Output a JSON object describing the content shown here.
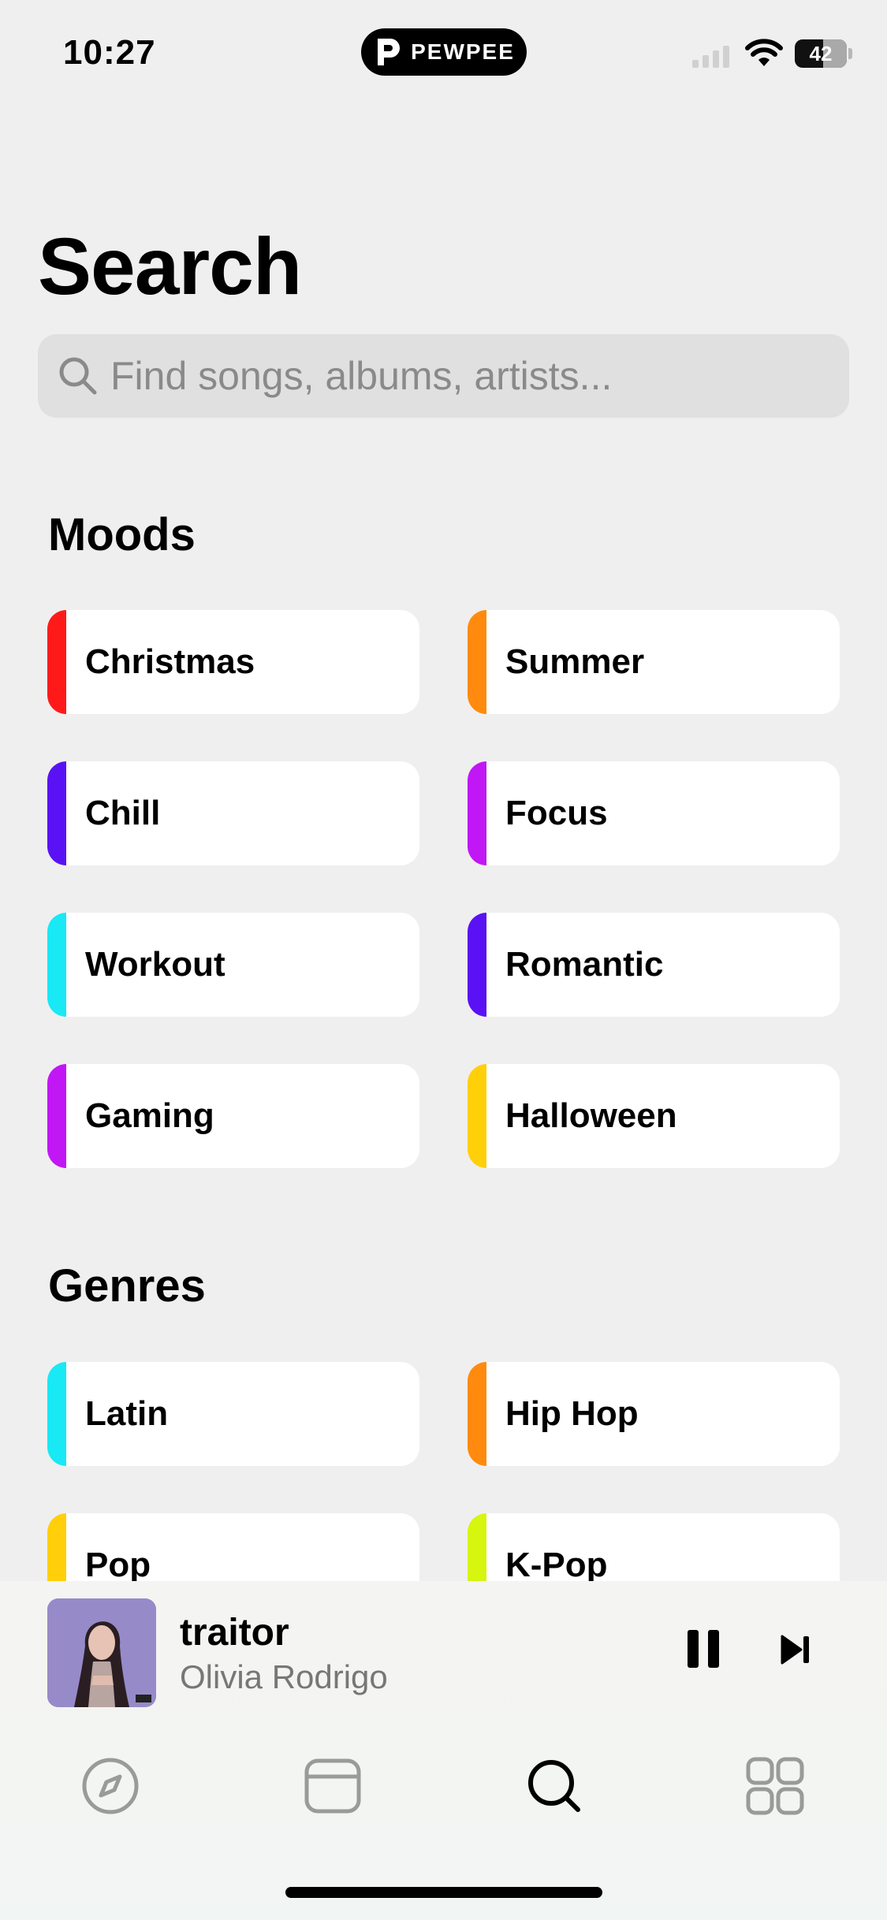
{
  "status_bar": {
    "time": "10:27",
    "app_badge": "PEWPEE",
    "battery": "42"
  },
  "header": {
    "title": "Search"
  },
  "search": {
    "placeholder": "Find songs, albums, artists..."
  },
  "moods": {
    "title": "Moods",
    "items": [
      {
        "label": "Christmas",
        "color": "#ff1a1a"
      },
      {
        "label": "Summer",
        "color": "#ff8a0d"
      },
      {
        "label": "Chill",
        "color": "#5a12f5"
      },
      {
        "label": "Focus",
        "color": "#c117f5"
      },
      {
        "label": "Workout",
        "color": "#19e8f5"
      },
      {
        "label": "Romantic",
        "color": "#5a12f5"
      },
      {
        "label": "Gaming",
        "color": "#c117f5"
      },
      {
        "label": "Halloween",
        "color": "#ffcf0a"
      }
    ]
  },
  "genres": {
    "title": "Genres",
    "items": [
      {
        "label": "Latin",
        "color": "#19e8f5"
      },
      {
        "label": "Hip Hop",
        "color": "#ff8a0d"
      },
      {
        "label": "Pop",
        "color": "#ffcf0a"
      },
      {
        "label": "K-Pop",
        "color": "#d6f50f"
      }
    ]
  },
  "now_playing": {
    "title": "traitor",
    "artist": "Olivia Rodrigo"
  },
  "tabs": [
    {
      "icon": "compass-icon",
      "name": "tab-explore"
    },
    {
      "icon": "card-icon",
      "name": "tab-library"
    },
    {
      "icon": "search-icon",
      "name": "tab-search",
      "active": true
    },
    {
      "icon": "grid-icon",
      "name": "tab-more"
    }
  ]
}
